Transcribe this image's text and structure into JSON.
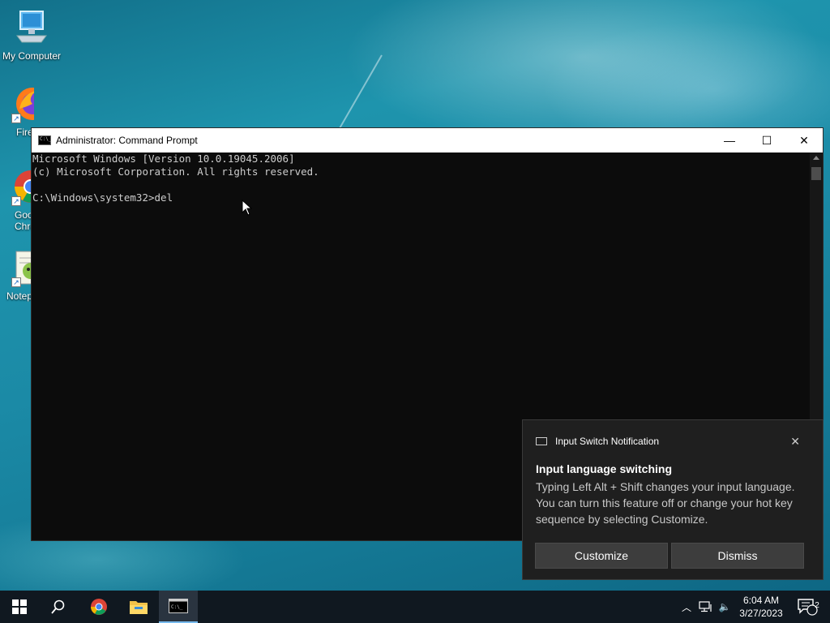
{
  "desktop": {
    "icons": [
      {
        "label": "My Computer"
      },
      {
        "label": "Fire"
      },
      {
        "label": "Goo"
      },
      {
        "label": "Chro"
      },
      {
        "label": "Notep"
      }
    ]
  },
  "cmd": {
    "title": "Administrator: Command Prompt",
    "lines": [
      "Microsoft Windows [Version 10.0.19045.2006]",
      "(c) Microsoft Corporation. All rights reserved.",
      "",
      "C:\\Windows\\system32>del"
    ],
    "minimize": "—",
    "maximize": "☐",
    "close": "✕"
  },
  "toast": {
    "app": "Input Switch Notification",
    "close": "✕",
    "title": "Input language switching",
    "body": "Typing Left Alt + Shift changes your input language. You can turn this feature off or change your hot key sequence by selecting Customize.",
    "customize": "Customize",
    "dismiss": "Dismiss"
  },
  "taskbar": {
    "time": "6:04 AM",
    "date": "3/27/2023",
    "notification_count": "2",
    "tray_chevron": "︿",
    "volume": "🔈"
  },
  "colors": {
    "taskbar_bg": "#101820",
    "console_bg": "#0c0c0c",
    "console_text": "#cccccc",
    "toast_bg": "#1f1f1f",
    "accent": "#76b9ed"
  }
}
